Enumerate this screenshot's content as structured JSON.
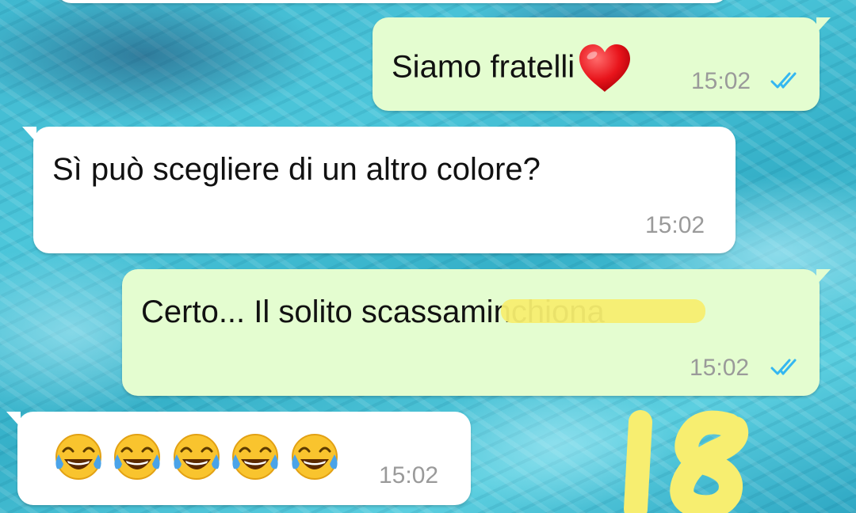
{
  "chat": {
    "messages": [
      {
        "direction": "outgoing",
        "text": "Siamo fratelli",
        "emoji": "heart",
        "time": "15:02",
        "status": "read"
      },
      {
        "direction": "incoming",
        "text": "Sì può scegliere di un altro colore?",
        "time": "15:02"
      },
      {
        "direction": "outgoing",
        "text": "Certo... Il solito scassaminchiona",
        "time": "15:02",
        "status": "read",
        "redacted": true
      },
      {
        "direction": "incoming",
        "text": "",
        "emoji": "face-with-tears-of-joy",
        "emoji_count": 5,
        "time": "15:02"
      }
    ]
  },
  "overlay": {
    "scribble": "18"
  },
  "colors": {
    "outgoing_bubble": "#e4fdd0",
    "incoming_bubble": "#ffffff",
    "read_ticks": "#34b7f1",
    "highlighter": "#f7ee70",
    "time_text": "#9a9a9a"
  }
}
